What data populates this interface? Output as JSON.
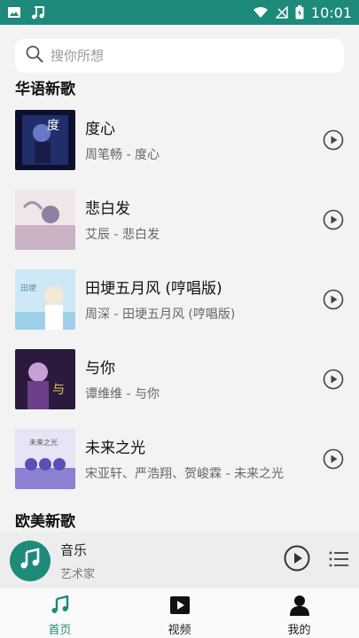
{
  "status_bar": {
    "time": "10:01",
    "left_icons": [
      "image-icon",
      "music-note-icon"
    ],
    "right_icons": [
      "wifi-icon",
      "signal-icon",
      "battery-icon"
    ]
  },
  "search": {
    "placeholder": "搜你所想"
  },
  "sections": {
    "chinese": {
      "title": "华语新歌"
    },
    "western": {
      "title": "欧美新歌"
    }
  },
  "songs": [
    {
      "title": "度心",
      "subtitle": "周笔畅 - 度心",
      "cover_colors": [
        "#0d0f2e",
        "#2a3c86",
        "#6a78c8"
      ]
    },
    {
      "title": "悲白发",
      "subtitle": "艾辰 - 悲白发",
      "cover_colors": [
        "#efe6e8",
        "#c9b3c4",
        "#8f7fa0"
      ]
    },
    {
      "title": "田埂五月风 (哼唱版)",
      "subtitle": "周深 - 田埂五月风 (哼唱版)",
      "cover_colors": [
        "#cfe8f5",
        "#9fd0ea",
        "#f2e8d8"
      ]
    },
    {
      "title": "与你",
      "subtitle": "谭维维 - 与你",
      "cover_colors": [
        "#2b1a3e",
        "#6b3f8a",
        "#c9a0d6"
      ]
    },
    {
      "title": "未来之光",
      "subtitle": "宋亚轩、严浩翔、贺峻霖 - 未来之光",
      "cover_colors": [
        "#e8e4f6",
        "#8b80d2",
        "#5a4fb8"
      ]
    }
  ],
  "player": {
    "title": "音乐",
    "artist": "艺术家"
  },
  "tabs": [
    {
      "label": "首页",
      "icon": "music-note-icon",
      "active": true
    },
    {
      "label": "视频",
      "icon": "video-play-icon",
      "active": false
    },
    {
      "label": "我的",
      "icon": "person-icon",
      "active": false
    }
  ],
  "colors": {
    "accent": "#1e8a79",
    "background": "#f3f3f3"
  }
}
